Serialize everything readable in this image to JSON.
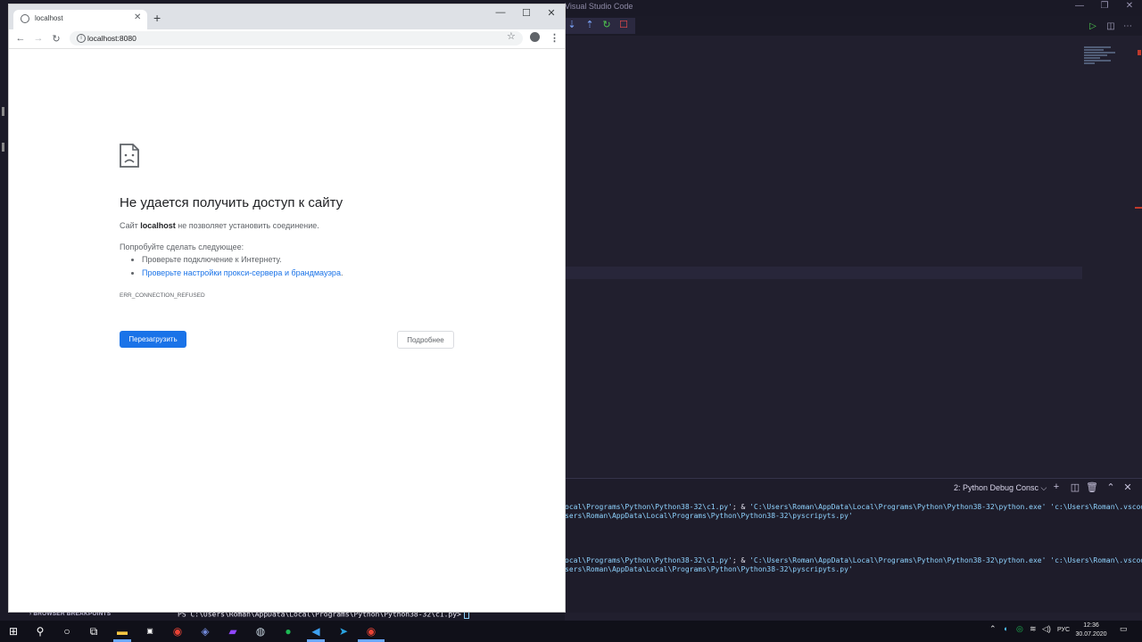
{
  "vscode": {
    "window_title": "Visual Studio Code",
    "panel": {
      "terminal_select": "2: Python Debug Consc ⌵",
      "terminal_lines": [
        {
          "part1": "ocal\\Programs\\Python\\Python38-32\\c1.py'",
          "sep": "; & ",
          "part2": "'C:\\Users\\Roman\\AppData\\Local\\Programs\\Python\\Python38-32\\python.exe' 'c:\\Users\\Roman\\.vscode\\exte"
        },
        {
          "part1": "sers\\Roman\\AppData\\Local\\Programs\\Python\\Python38-32\\pyscripyts.py'",
          "sep": "",
          "part2": ""
        },
        {
          "part1": "ocal\\Programs\\Python\\Python38-32\\c1.py'",
          "sep": "; & ",
          "part2": "'C:\\Users\\Roman\\AppData\\Local\\Programs\\Python\\Python38-32\\python.exe' 'c:\\Users\\Roman\\.vscode\\exte"
        },
        {
          "part1": "sers\\Roman\\AppData\\Local\\Programs\\Python\\Python38-32\\pyscripyts.py'",
          "sep": "",
          "part2": ""
        }
      ]
    },
    "breakpoints_label": "BROWSER BREAKPOINTS",
    "prompt": "PS C:\\Users\\Roman\\AppData\\Local\\Programs\\Python\\Python38-32\\c1.py>"
  },
  "chrome": {
    "tab_title": "localhost",
    "url": "localhost:8080",
    "error": {
      "title": "Не удается получить доступ к сайту",
      "desc_prefix": "Сайт ",
      "desc_host": "localhost",
      "desc_suffix": " не позволяет установить соединение.",
      "try_label": "Попробуйте сделать следующее:",
      "suggestion_1": "Проверьте подключение к Интернету.",
      "suggestion_2_link": "Проверьте настройки прокси-сервера и брандмауэра",
      "suggestion_2_end": ".",
      "code": "ERR_CONNECTION_REFUSED",
      "reload_button": "Перезагрузить",
      "details_button": "Подробнее"
    }
  },
  "taskbar": {
    "language": "РУС",
    "time": "12:36",
    "date": "30.07.2020"
  },
  "colors": {
    "chrome_blue": "#1a73e8",
    "vscode_bg": "#211f2e",
    "terminal_cyan": "#8fd3ff"
  }
}
